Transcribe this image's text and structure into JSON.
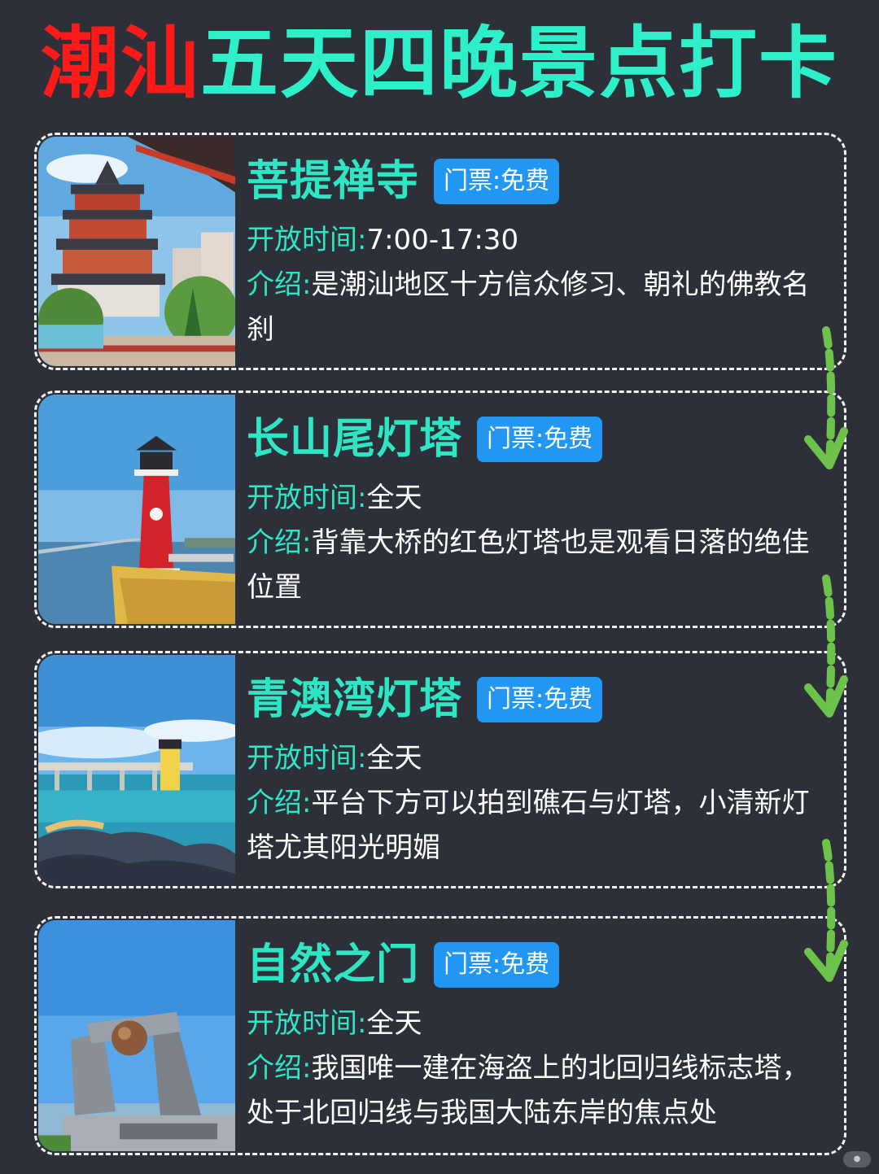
{
  "title": {
    "part1": "潮汕",
    "part2": "五天四晚景点打卡"
  },
  "colors": {
    "background": "#2e3039",
    "accent_cyan": "#2ee6c4",
    "title_red": "#ff1a1a",
    "ticket_blue": "#2196f3",
    "arrow_green": "#6cc24a"
  },
  "labels": {
    "hours_key": "开放时间:",
    "intro_key": "介绍:"
  },
  "spots": [
    {
      "name": "菩提禅寺",
      "ticket": "门票:免费",
      "hours": "7:00-17:30",
      "intro": "是潮汕地区十方信众修习、朝礼的佛教名刹",
      "photo_icon": "temple-pagoda-photo"
    },
    {
      "name": "长山尾灯塔",
      "ticket": "门票:免费",
      "hours": "全天",
      "intro": "背靠大桥的红色灯塔也是观看日落的绝佳位置",
      "photo_icon": "red-lighthouse-photo"
    },
    {
      "name": "青澳湾灯塔",
      "ticket": "门票:免费",
      "hours": "全天",
      "intro": "平台下方可以拍到礁石与灯塔，小清新灯塔尤其阳光明媚",
      "photo_icon": "seaside-lighthouse-photo"
    },
    {
      "name": "自然之门",
      "ticket": "门票:免费",
      "hours": "全天",
      "intro": "我国唯一建在海盗上的北回归线标志塔，处于北回归线与我国大陆东岸的焦点处",
      "photo_icon": "gate-monument-photo"
    }
  ]
}
